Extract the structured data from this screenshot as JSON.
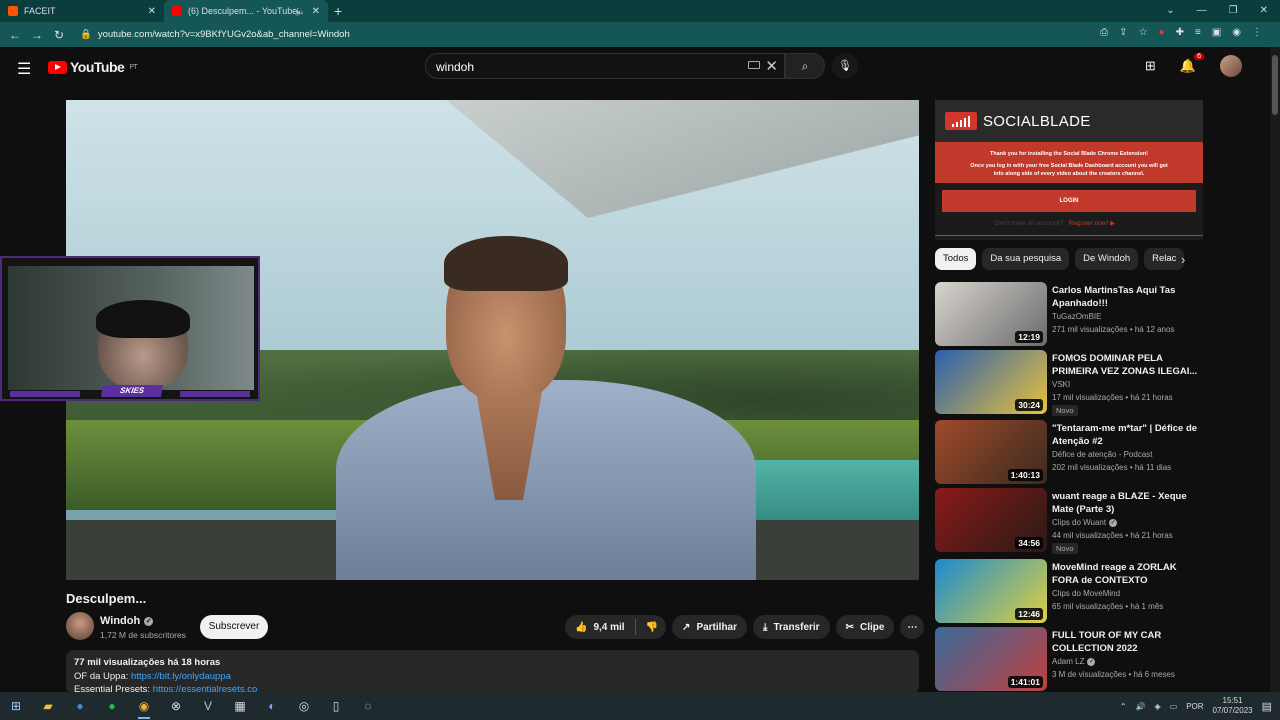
{
  "browser": {
    "tabs": [
      {
        "title": "FACEIT",
        "color": "#ff5500"
      },
      {
        "title": "(6) Desculpem... - YouTube",
        "color": "#ff0000"
      }
    ],
    "url": "youtube.com/watch?v=x9BKfYUGv2o&ab_channel=Windoh"
  },
  "header": {
    "logo_text": "YouTube",
    "region": "PT",
    "search_value": "windoh",
    "notif_count": "6"
  },
  "video": {
    "title": "Desculpem...",
    "channel": "Windoh",
    "subscribers": "1,72 M de subscritores",
    "subscribe_label": "Subscrever",
    "likes": "9,4 mil",
    "share_label": "Partilhar",
    "download_label": "Transferir",
    "clip_label": "Clipe",
    "webcam_name": "SKIES"
  },
  "description": {
    "stats": "77 mil visualizações  há 18 horas",
    "line1_label": "OF da Uppa:",
    "line1_link": "https://bit.ly/onlydauppa",
    "line2_label": "Essential Presets:",
    "line2_link": "https://essentialresets.co"
  },
  "socialblade": {
    "name": "SOCIALBLADE",
    "notice1": "Thank you for installing the Social Blade Chrome Extension!",
    "notice2": "Once you log in with your free Social Blade Dashboard account you will get info along side of every video about the creators channel.",
    "login_label": "LOGIN",
    "register_prefix": "Don't have an account?",
    "register_label": "Register now! ▶"
  },
  "chips": [
    "Todos",
    "Da sua pesquisa",
    "De Windoh",
    "Relac"
  ],
  "recommendations": [
    {
      "title": "Carlos MartinsTas Aqui Tas Apanhado!!!",
      "channel": "TuGazOmBIE",
      "verified": false,
      "meta": "271 mil visualizações  •  há 12 anos",
      "duration": "12:19",
      "novo": false,
      "colors": [
        "#d8d4cf",
        "#6b6b6b"
      ]
    },
    {
      "title": "FOMOS DOMINAR PELA PRIMEIRA VEZ ZONAS ILEGAI...",
      "channel": "VSKI",
      "verified": false,
      "meta": "17 mil visualizações  •  há 21 horas",
      "duration": "30:24",
      "novo": true,
      "colors": [
        "#2a5fb0",
        "#e8c23a"
      ]
    },
    {
      "title": "\"Tentaram-me m*tar\" | Défice de Atenção #2",
      "channel": "Défice de atenção - Podcast",
      "verified": false,
      "meta": "202 mil visualizações  •  há 11 dias",
      "duration": "1:40:13",
      "novo": false,
      "colors": [
        "#a04a2a",
        "#3a2a20"
      ]
    },
    {
      "title": "wuant reage a BLAZE - Xeque Mate (Parte 3)",
      "channel": "Clips do Wuant",
      "verified": true,
      "meta": "44 mil visualizações  •  há 21 horas",
      "duration": "34:56",
      "novo": true,
      "colors": [
        "#8a1a1a",
        "#2a1a14"
      ]
    },
    {
      "title": "MoveMind reage a ZORLAK FORA de CONTEXTO",
      "channel": "Clips do MoveMind",
      "verified": false,
      "meta": "65 mil visualizações  •  há 1 mês",
      "duration": "12:46",
      "novo": false,
      "colors": [
        "#1a8ad0",
        "#e0d040"
      ]
    },
    {
      "title": "FULL TOUR OF MY CAR COLLECTION 2022",
      "channel": "Adam LZ",
      "verified": true,
      "meta": "3 M de visualizações  •  há 6 meses",
      "duration": "1:41:01",
      "novo": false,
      "colors": [
        "#3a6a9a",
        "#c04040"
      ]
    }
  ],
  "taskbar": {
    "lang": "POR",
    "time": "15:51",
    "date": "07/07/2023"
  }
}
